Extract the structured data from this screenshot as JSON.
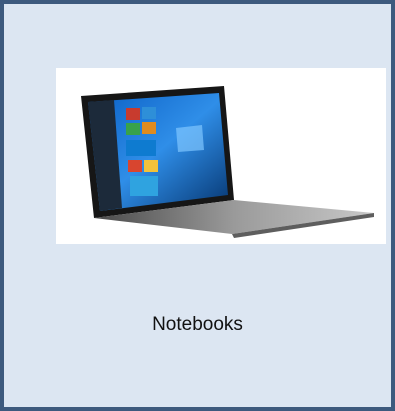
{
  "category_card": {
    "label": "Notebooks",
    "image_icon": "laptop-icon",
    "colors": {
      "border": "#3d5a7e",
      "background": "#dce6f2",
      "image_background": "#ffffff"
    }
  }
}
